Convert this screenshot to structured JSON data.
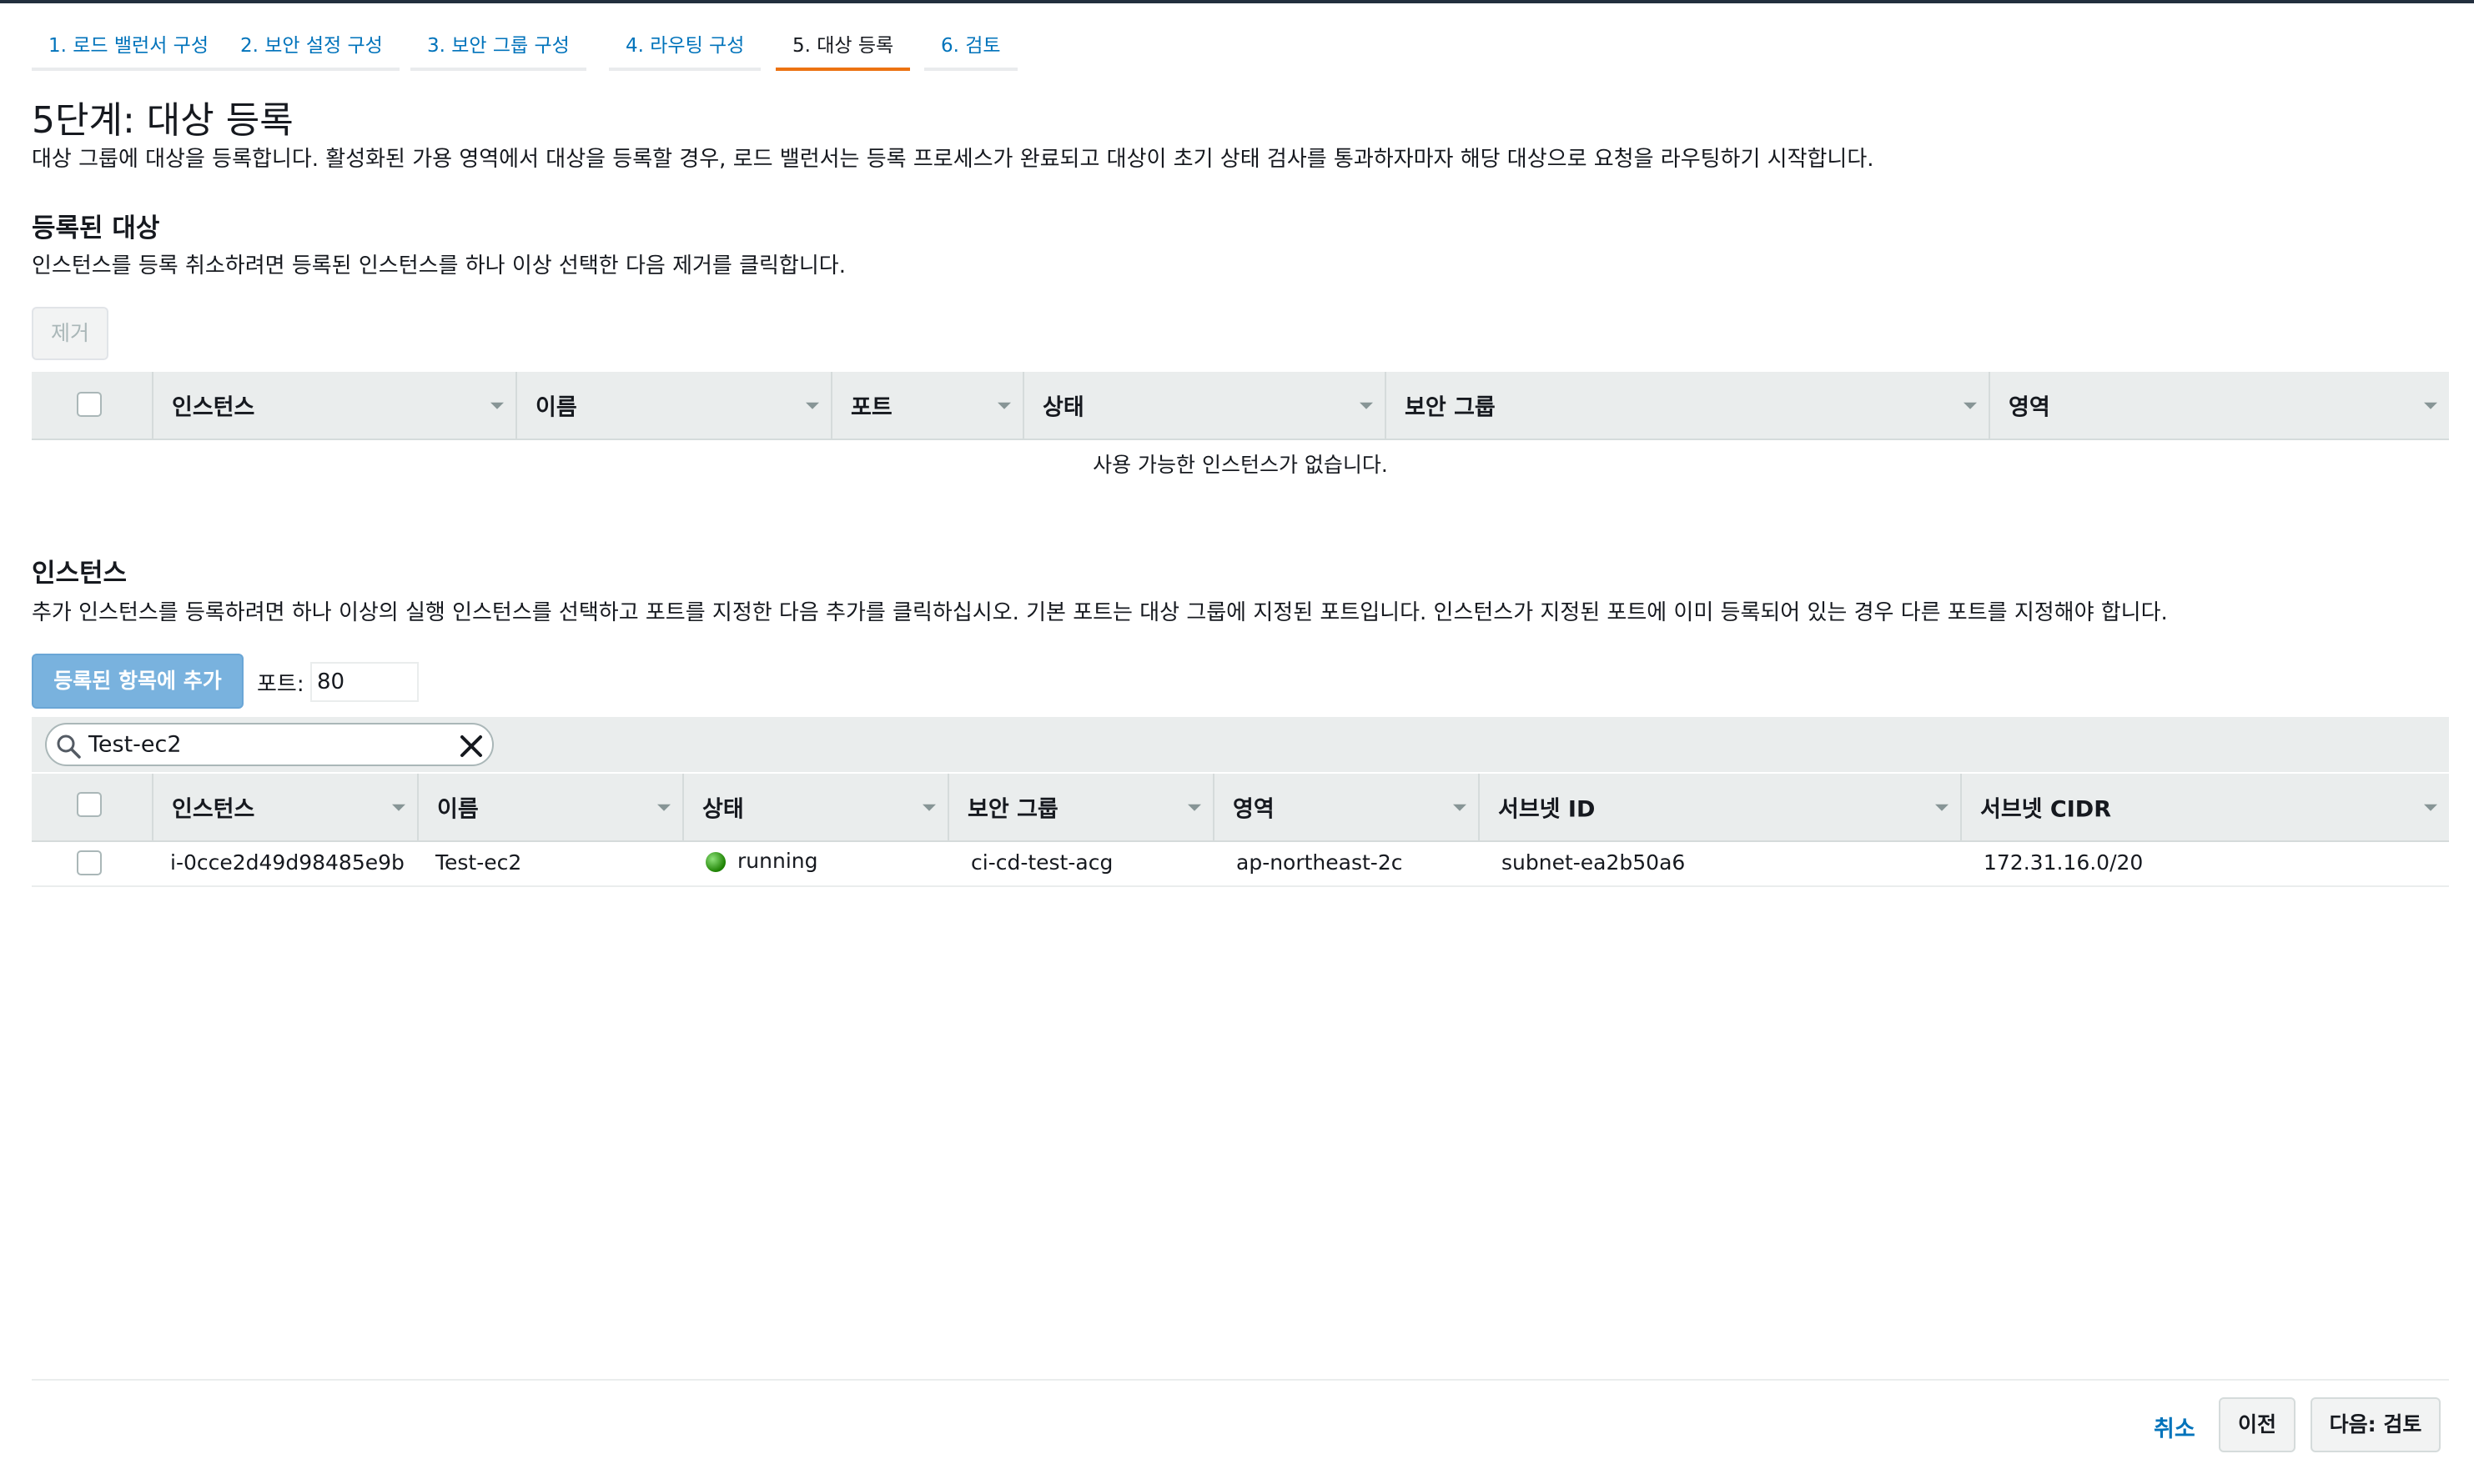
{
  "wizard": {
    "tabs": [
      {
        "label": "1. 로드 밸런서 구성"
      },
      {
        "label": "2. 보안 설정 구성"
      },
      {
        "label": "3. 보안 그룹 구성"
      },
      {
        "label": "4. 라우팅 구성"
      },
      {
        "label": "5. 대상 등록",
        "active": true
      },
      {
        "label": "6. 검토"
      }
    ]
  },
  "page": {
    "title": "5단계: 대상 등록",
    "description": "대상 그룹에 대상을 등록합니다. 활성화된 가용 영역에서 대상을 등록할 경우, 로드 밸런서는 등록 프로세스가 완료되고 대상이 초기 상태 검사를 통과하자마자 해당 대상으로 요청을 라우팅하기 시작합니다."
  },
  "registered": {
    "title": "등록된 대상",
    "description": "인스턴스를 등록 취소하려면 등록된 인스턴스를 하나 이상 선택한 다음 제거를 클릭합니다.",
    "remove_label": "제거",
    "columns": [
      "인스턴스",
      "이름",
      "포트",
      "상태",
      "보안 그룹",
      "영역"
    ],
    "empty_message": "사용 가능한 인스턴스가 없습니다."
  },
  "instances": {
    "title": "인스턴스",
    "description": "추가 인스턴스를 등록하려면 하나 이상의 실행 인스턴스를 선택하고 포트를 지정한 다음 추가를 클릭하십시오. 기본 포트는 대상 그룹에 지정된 포트입니다. 인스턴스가 지정된 포트에 이미 등록되어 있는 경우 다른 포트를 지정해야 합니다.",
    "add_label": "등록된 항목에 추가",
    "port_label": "포트:",
    "port_value": "80",
    "search_value": "Test-ec2",
    "columns": [
      "인스턴스",
      "이름",
      "상태",
      "보안 그룹",
      "영역",
      "서브넷 ID",
      "서브넷 CIDR"
    ],
    "rows": [
      {
        "instance": "i-0cce2d49d98485e9b",
        "name": "Test-ec2",
        "state": "running",
        "security_group": "ci-cd-test-acg",
        "zone": "ap-northeast-2c",
        "subnet_id": "subnet-ea2b50a6",
        "subnet_cidr": "172.31.16.0/20"
      }
    ]
  },
  "footer": {
    "cancel_label": "취소",
    "prev_label": "이전",
    "next_label": "다음: 검토"
  },
  "colors": {
    "link": "#0073bb",
    "active_tab_underline": "#ec7211",
    "primary_button": "#79b2de",
    "running": "#1d8102"
  },
  "icons": {
    "search": "search-icon",
    "clear": "close-icon",
    "sort": "caret-down-icon",
    "status": "status-running-icon"
  }
}
